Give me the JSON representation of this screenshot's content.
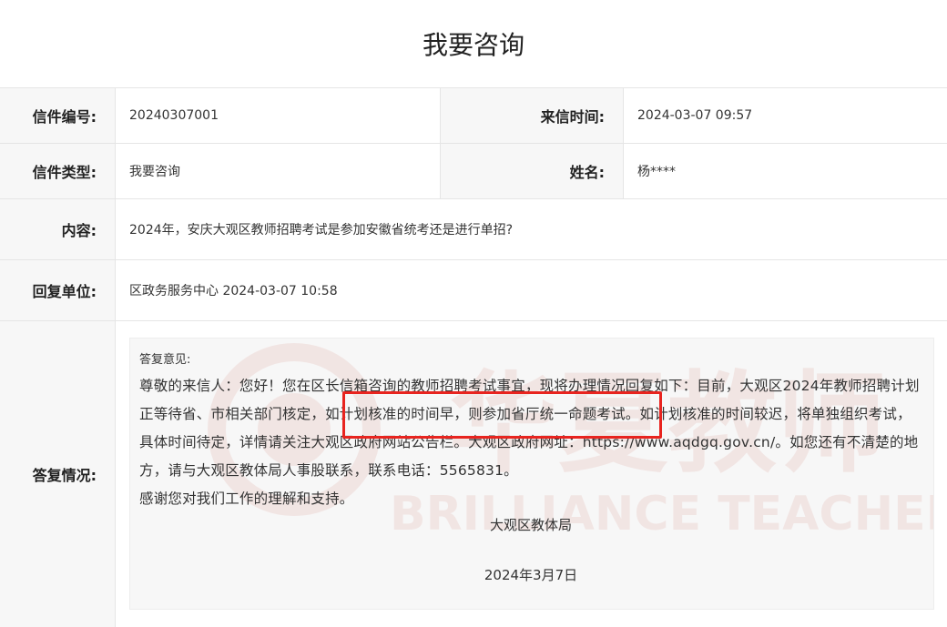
{
  "page_title": "我要咨询",
  "letter": {
    "number_label": "信件编号:",
    "number_value": "20240307001",
    "time_label": "来信时间:",
    "time_value": "2024-03-07 09:57",
    "type_label": "信件类型:",
    "type_value": "我要咨询",
    "name_label": "姓名:",
    "name_value": "杨****",
    "content_label": "内容:",
    "content_value": "2024年，安庆大观区教师招聘考试是参加安徽省统考还是进行单招?",
    "unit_label": "回复单位:",
    "unit_value": "区政务服务中心 2024-03-07 10:58",
    "reply_label": "答复情况:"
  },
  "reply": {
    "heading": "答复意见:",
    "body": "尊敬的来信人：您好！您在区长信箱咨询的教师招聘考试事宜，现将办理情况回复如下：目前，大观区2024年教师招聘计划正等待省、市相关部门核定，如计划核准的时间早，则参加省厅统一命题考试。如计划核准的时间较迟，将单独组织考试，具体时间待定，详情请关注大观区政府网站公告栏。大观区政府网址：https://www.aqdgq.gov.cn/。如您还有不清楚的地方，请与大观区教体局人事股联系，联系电话：5565831。",
    "thanks": "感谢您对我们工作的理解和支持。",
    "signature": "大观区教体局",
    "date": "2024年3月7日"
  },
  "watermark": {
    "cn_text": "华夏教师",
    "en_text": "BRILLIANCE TEACHER"
  },
  "colors": {
    "highlight": "#e8241f",
    "label_bg": "#f7f7f7",
    "watermark": "#c0392b"
  }
}
